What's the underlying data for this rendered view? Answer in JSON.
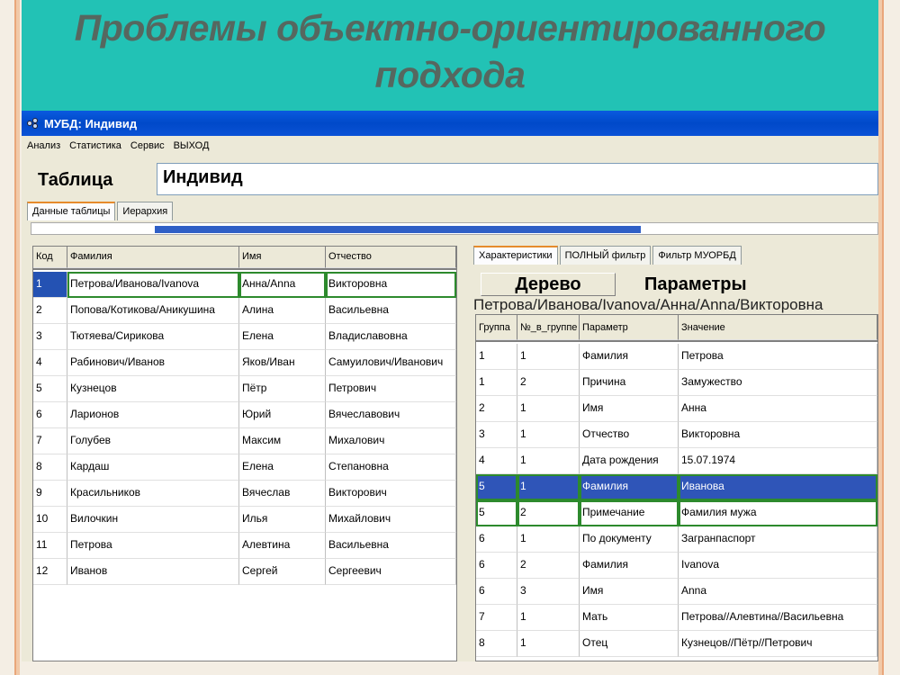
{
  "slide": {
    "title_line1": "Проблемы объектно-ориентированного",
    "title_line2": "подхода"
  },
  "window": {
    "title": "МУБД:  Индивид",
    "menu": [
      "Анализ",
      "Статистика",
      "Сервис",
      "ВЫХОД"
    ],
    "table_label": "Таблица",
    "table_name": "Индивид",
    "tabs": [
      "Данные таблицы",
      "Иерархия"
    ]
  },
  "left_grid": {
    "columns": [
      "Код",
      "Фамилия",
      "Имя",
      "Отчество"
    ],
    "rows": [
      [
        "1",
        "Петрова/Иванова/Ivanova",
        "Анна/Anna",
        "Викторовна"
      ],
      [
        "2",
        "Попова/Котикова/Аникушина",
        "Алина",
        "Васильевна"
      ],
      [
        "3",
        "Тютяева/Сирикова",
        "Елена",
        "Владиславовна"
      ],
      [
        "4",
        "Рабинович/Иванов",
        "Яков/Иван",
        "Самуилович/Иванович"
      ],
      [
        "5",
        "Кузнецов",
        "Пётр",
        "Петрович"
      ],
      [
        "6",
        "Ларионов",
        "Юрий",
        "Вячеславович"
      ],
      [
        "7",
        "Голубев",
        "Максим",
        "Михалович"
      ],
      [
        "8",
        "Кардаш",
        "Елена",
        "Степановна"
      ],
      [
        "9",
        "Красильников",
        "Вячеслав",
        "Викторович"
      ],
      [
        "10",
        "Вилочкин",
        "Илья",
        "Михайлович"
      ],
      [
        "11",
        "Петрова",
        "Алевтина",
        "Васильевна"
      ],
      [
        "12",
        "Иванов",
        "Сергей",
        "Сергеевич"
      ]
    ],
    "selected_row": 0
  },
  "right_panel": {
    "tabs": [
      "Характеристики",
      "ПОЛНЫЙ фильтр",
      "Фильтр МУОРБД"
    ],
    "tree_button": "Дерево",
    "params_label": "Параметры",
    "record_path": "Петрова/Иванова/Ivanova/Анна/Anna/Викторовна",
    "columns": [
      "Группа",
      "№_в_группе",
      "Параметр",
      "Значение"
    ],
    "rows": [
      [
        "1",
        "1",
        "Фамилия",
        "Петрова"
      ],
      [
        "1",
        "2",
        "Причина",
        "Замужество"
      ],
      [
        "2",
        "1",
        "Имя",
        "Анна"
      ],
      [
        "3",
        "1",
        "Отчество",
        "Викторовна"
      ],
      [
        "4",
        "1",
        "Дата рождения",
        "15.07.1974"
      ],
      [
        "5",
        "1",
        "Фамилия",
        "Иванова"
      ],
      [
        "5",
        "2",
        "Примечание",
        "Фамилия мужа"
      ],
      [
        "6",
        "1",
        "По документу",
        "Загранпаспорт"
      ],
      [
        "6",
        "2",
        "Фамилия",
        "Ivanova"
      ],
      [
        "6",
        "3",
        "Имя",
        "Anna"
      ],
      [
        "7",
        "1",
        "Мать",
        "Петрова//Алевтина//Васильевна"
      ],
      [
        "8",
        "1",
        "Отец",
        "Кузнецов//Пётр//Петрович"
      ]
    ],
    "highlighted_row": 5,
    "boxed_row": 6
  },
  "colors": {
    "title_band": "#22c2b5",
    "title_text": "#56675f",
    "titlebar": "#0a52d6",
    "selection": "#2f55b8",
    "focus_outline": "#2d8a2d"
  }
}
